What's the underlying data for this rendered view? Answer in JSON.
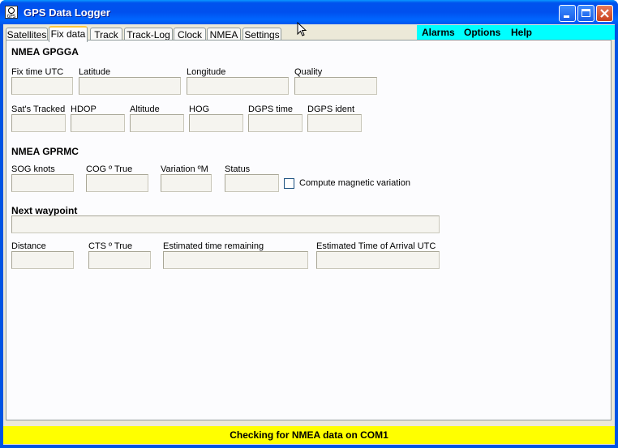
{
  "window": {
    "title": "GPS Data Logger",
    "icon_text": "GPS"
  },
  "tabs": [
    {
      "label": "Satellites"
    },
    {
      "label": "Fix data",
      "active": true
    },
    {
      "label": "Track"
    },
    {
      "label": "Track-Log"
    },
    {
      "label": "Clock"
    },
    {
      "label": "NMEA"
    },
    {
      "label": "Settings"
    }
  ],
  "menu": {
    "alarms": "Alarms",
    "options": "Options",
    "help": "Help"
  },
  "gpgga": {
    "heading": "NMEA GPGGA",
    "fix_time": "Fix time UTC",
    "latitude": "Latitude",
    "longitude": "Longitude",
    "quality": "Quality",
    "sats_tracked": "Sat's Tracked",
    "hdop": "HDOP",
    "altitude": "Altitude",
    "hog": "HOG",
    "dgps_time": "DGPS time",
    "dgps_ident": "DGPS ident"
  },
  "gprmc": {
    "heading": "NMEA GPRMC",
    "sog": "SOG knots",
    "cog": "COG º True",
    "variation": "Variation ºM",
    "status": "Status",
    "compute_mag": "Compute magnetic variation"
  },
  "waypoint": {
    "heading": "Next waypoint",
    "distance": "Distance",
    "cts": "CTS º True",
    "etr": "Estimated time remaining",
    "eta": "Estimated Time of Arrival UTC"
  },
  "status_bar": {
    "text": "Checking for NMEA data on COM1"
  },
  "colors": {
    "titlebar": "#0054e3",
    "menubar_bg": "#00ffff",
    "statusbar_bg": "#ffff00",
    "active_tab_accent": "#ffc83c"
  }
}
